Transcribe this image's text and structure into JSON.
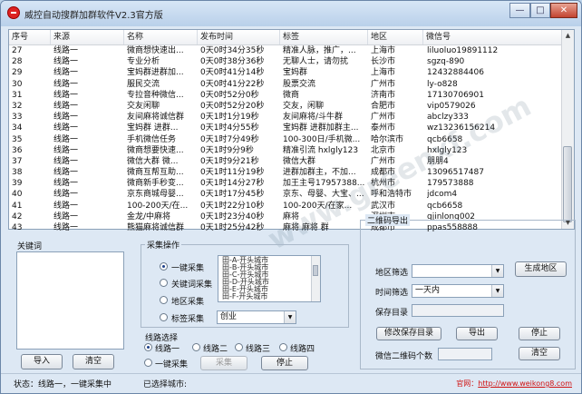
{
  "window": {
    "title": "威控自动搜群加群软件V2.3官方版",
    "minimize_glyph": "—",
    "restore_glyph": "□",
    "close_glyph": "✕"
  },
  "table": {
    "headers": [
      "序号",
      "来源",
      "名称",
      "发布时间",
      "标签",
      "地区",
      "微信号"
    ],
    "rows": [
      [
        "27",
        "线路一",
        "微商想快速出...",
        "0天0时34分35秒",
        "精准人脉，推广，...",
        "上海市",
        "liluoluo19891112"
      ],
      [
        "28",
        "线路一",
        "专业分析",
        "0天0时38分36秒",
        "无聊人士，请勿扰",
        "长沙市",
        "sgzq-890"
      ],
      [
        "29",
        "线路一",
        "宝妈群进群加...",
        "0天0时41分14秒",
        "宝妈群",
        "上海市",
        "12432884406"
      ],
      [
        "30",
        "线路一",
        "服民交流",
        "0天0时41分22秒",
        "股票交流",
        "广州市",
        "ly-o828"
      ],
      [
        "31",
        "线路一",
        "专拉音种微信...",
        "0天0时52分0秒",
        "微商",
        "济南市",
        "17130706901"
      ],
      [
        "32",
        "线路一",
        "交友闲聊",
        "0天0时52分20秒",
        "交友，闲聊",
        "合肥市",
        "vip0579026"
      ],
      [
        "33",
        "线路一",
        "友间麻将诚信群",
        "0天1时1分19秒",
        "友间麻将/斗牛群",
        "广州市",
        "abclzy333"
      ],
      [
        "34",
        "线路一",
        "宝妈群 进群...",
        "0天1时4分55秒",
        "宝妈群 进群加群主...",
        "泰州市",
        "wz13236156214"
      ],
      [
        "35",
        "线路一",
        "手机微信任务",
        "0天1时7分49秒",
        "100-300日/手机微...",
        "哈尔滨市",
        "qcb6658"
      ],
      [
        "36",
        "线路一",
        "微商想要快速...",
        "0天1时9分9秒",
        "精准引流 hxlgly123",
        "北京市",
        "hxlgly123"
      ],
      [
        "37",
        "线路一",
        "微信大群 微...",
        "0天1时9分21秒",
        "微信大群",
        "广州市",
        "朋朋4"
      ],
      [
        "38",
        "线路一",
        "微商互帮互助...",
        "0天1时11分19秒",
        "进群加群主，不加...",
        "成都市",
        "13096517487"
      ],
      [
        "39",
        "线路一",
        "微商新手秒变...",
        "0天1时14分27秒",
        "加王主号17957388...",
        "杭州市",
        "179573888"
      ],
      [
        "40",
        "线路一",
        "京东商城母婴...",
        "0天1时17分45秒",
        "京东、母婴、大宝、...",
        "呼和浩特市",
        "jdcom4"
      ],
      [
        "41",
        "线路一",
        "100-200天/在...",
        "0天1时22分10秒",
        "100-200天/在家...",
        "武汉市",
        "qcb6658"
      ],
      [
        "42",
        "线路一",
        "金龙/中麻将",
        "0天1时23分40秒",
        "麻将",
        "深圳市",
        "qjinlong002"
      ],
      [
        "43",
        "线路一",
        "熊猫麻将诚信群",
        "0天1时25分42秒",
        "麻将 麻将 群",
        "成都市",
        "ppas558888"
      ]
    ]
  },
  "keyword_panel": {
    "label": "关键词",
    "import_label": "导入",
    "clear_label": "清空"
  },
  "collect_panel": {
    "label": "采集操作",
    "modes": [
      "一键采集",
      "关键词采集",
      "地区采集",
      "标签采集"
    ],
    "city_items": [
      "田-A-开头城市",
      "田-B-开头城市",
      "田-C-开头城市",
      "田-D-开头城市",
      "田-E-开头城市",
      "田-F-开头城市"
    ],
    "tag_select_value": "创业"
  },
  "route_panel": {
    "label": "线路选择",
    "routes": [
      "线路一",
      "线路二",
      "线路三",
      "线路四"
    ],
    "one_key_label": "一键采集",
    "collect_label": "采集",
    "stop_label": "停止",
    "selected_city_label": "已选择城市:"
  },
  "qr_panel": {
    "label": "二维码导出",
    "region_filter_label": "地区筛选",
    "generate_region_label": "生成地区",
    "time_filter_label": "时间筛选",
    "time_filter_value": "一天内",
    "save_dir_label": "保存目录",
    "modify_dir_label": "修改保存目录",
    "export_label": "导出",
    "stop_label": "停止",
    "qr_count_label": "微信二维码个数",
    "clear_label": "清空"
  },
  "status": {
    "text": "状态：线路一，一键采集中",
    "website_prefix": "官网：",
    "website_url": "http://www.weikong8.com"
  }
}
